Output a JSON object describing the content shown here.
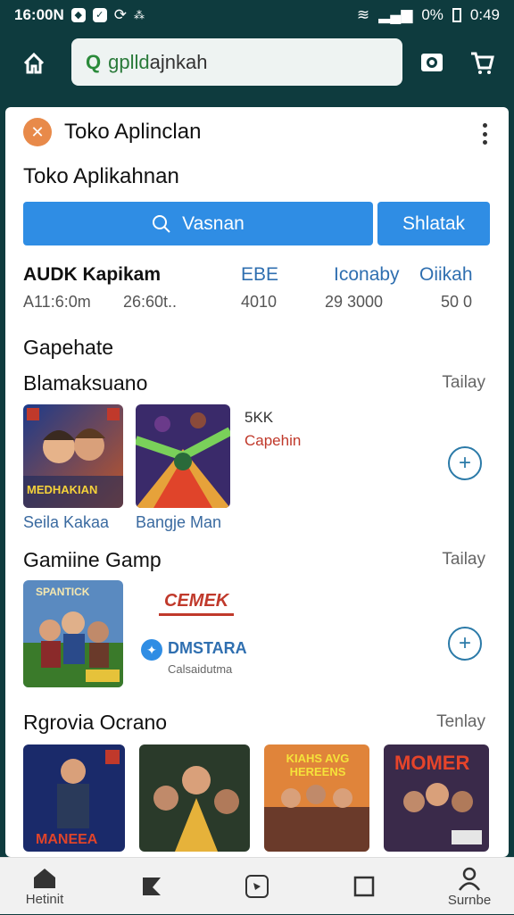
{
  "status": {
    "time_left": "16:00N",
    "battery": "0%",
    "time_right": "0:49"
  },
  "search": {
    "query_prefix": "gplld",
    "query_rest": " ajnkah"
  },
  "app": {
    "title": "Toko Aplinclan",
    "subtitle": "Toko Aplikahnan"
  },
  "buttons": {
    "search_label": "Vasnan",
    "other_label": "Shlatak"
  },
  "stats": {
    "headers": [
      "AUDK Kapikam",
      "EBE",
      "Iconaby",
      "Oiikah"
    ],
    "values": [
      "A11:6:0m",
      "26:60t..",
      "4010",
      "29 3000",
      "50 0"
    ]
  },
  "sections": {
    "games_label": "Gapehate",
    "s1": {
      "title": "Blamaksuano",
      "more": "Tailay",
      "badge": "5KK",
      "status": "Capehin",
      "thumbs": [
        {
          "caption": "Seila Kakaa"
        },
        {
          "caption": "Bangje Man"
        }
      ],
      "thumb1_art": "MEDHAKIAN"
    },
    "s2": {
      "title": "Gamiine Gamp",
      "more": "Tailay",
      "promo": "CEMEK",
      "brand": "DMSTARA",
      "brand_sub": "Calsaidutma",
      "thumb_art": "SPANTICK"
    },
    "s3": {
      "title": "Rgrovia Ocrano",
      "more": "Tenlay",
      "arts": [
        "MANEEA",
        "",
        "KIAHS AVG HEREENS",
        "MOMER"
      ]
    }
  },
  "nav": {
    "home": "Hetinit",
    "profile": "Surnbe"
  },
  "colors": {
    "header_bg": "#0e3b3e",
    "accent_blue": "#2f8de4",
    "link_blue": "#2b7aa8",
    "badge_red": "#c0392b"
  }
}
